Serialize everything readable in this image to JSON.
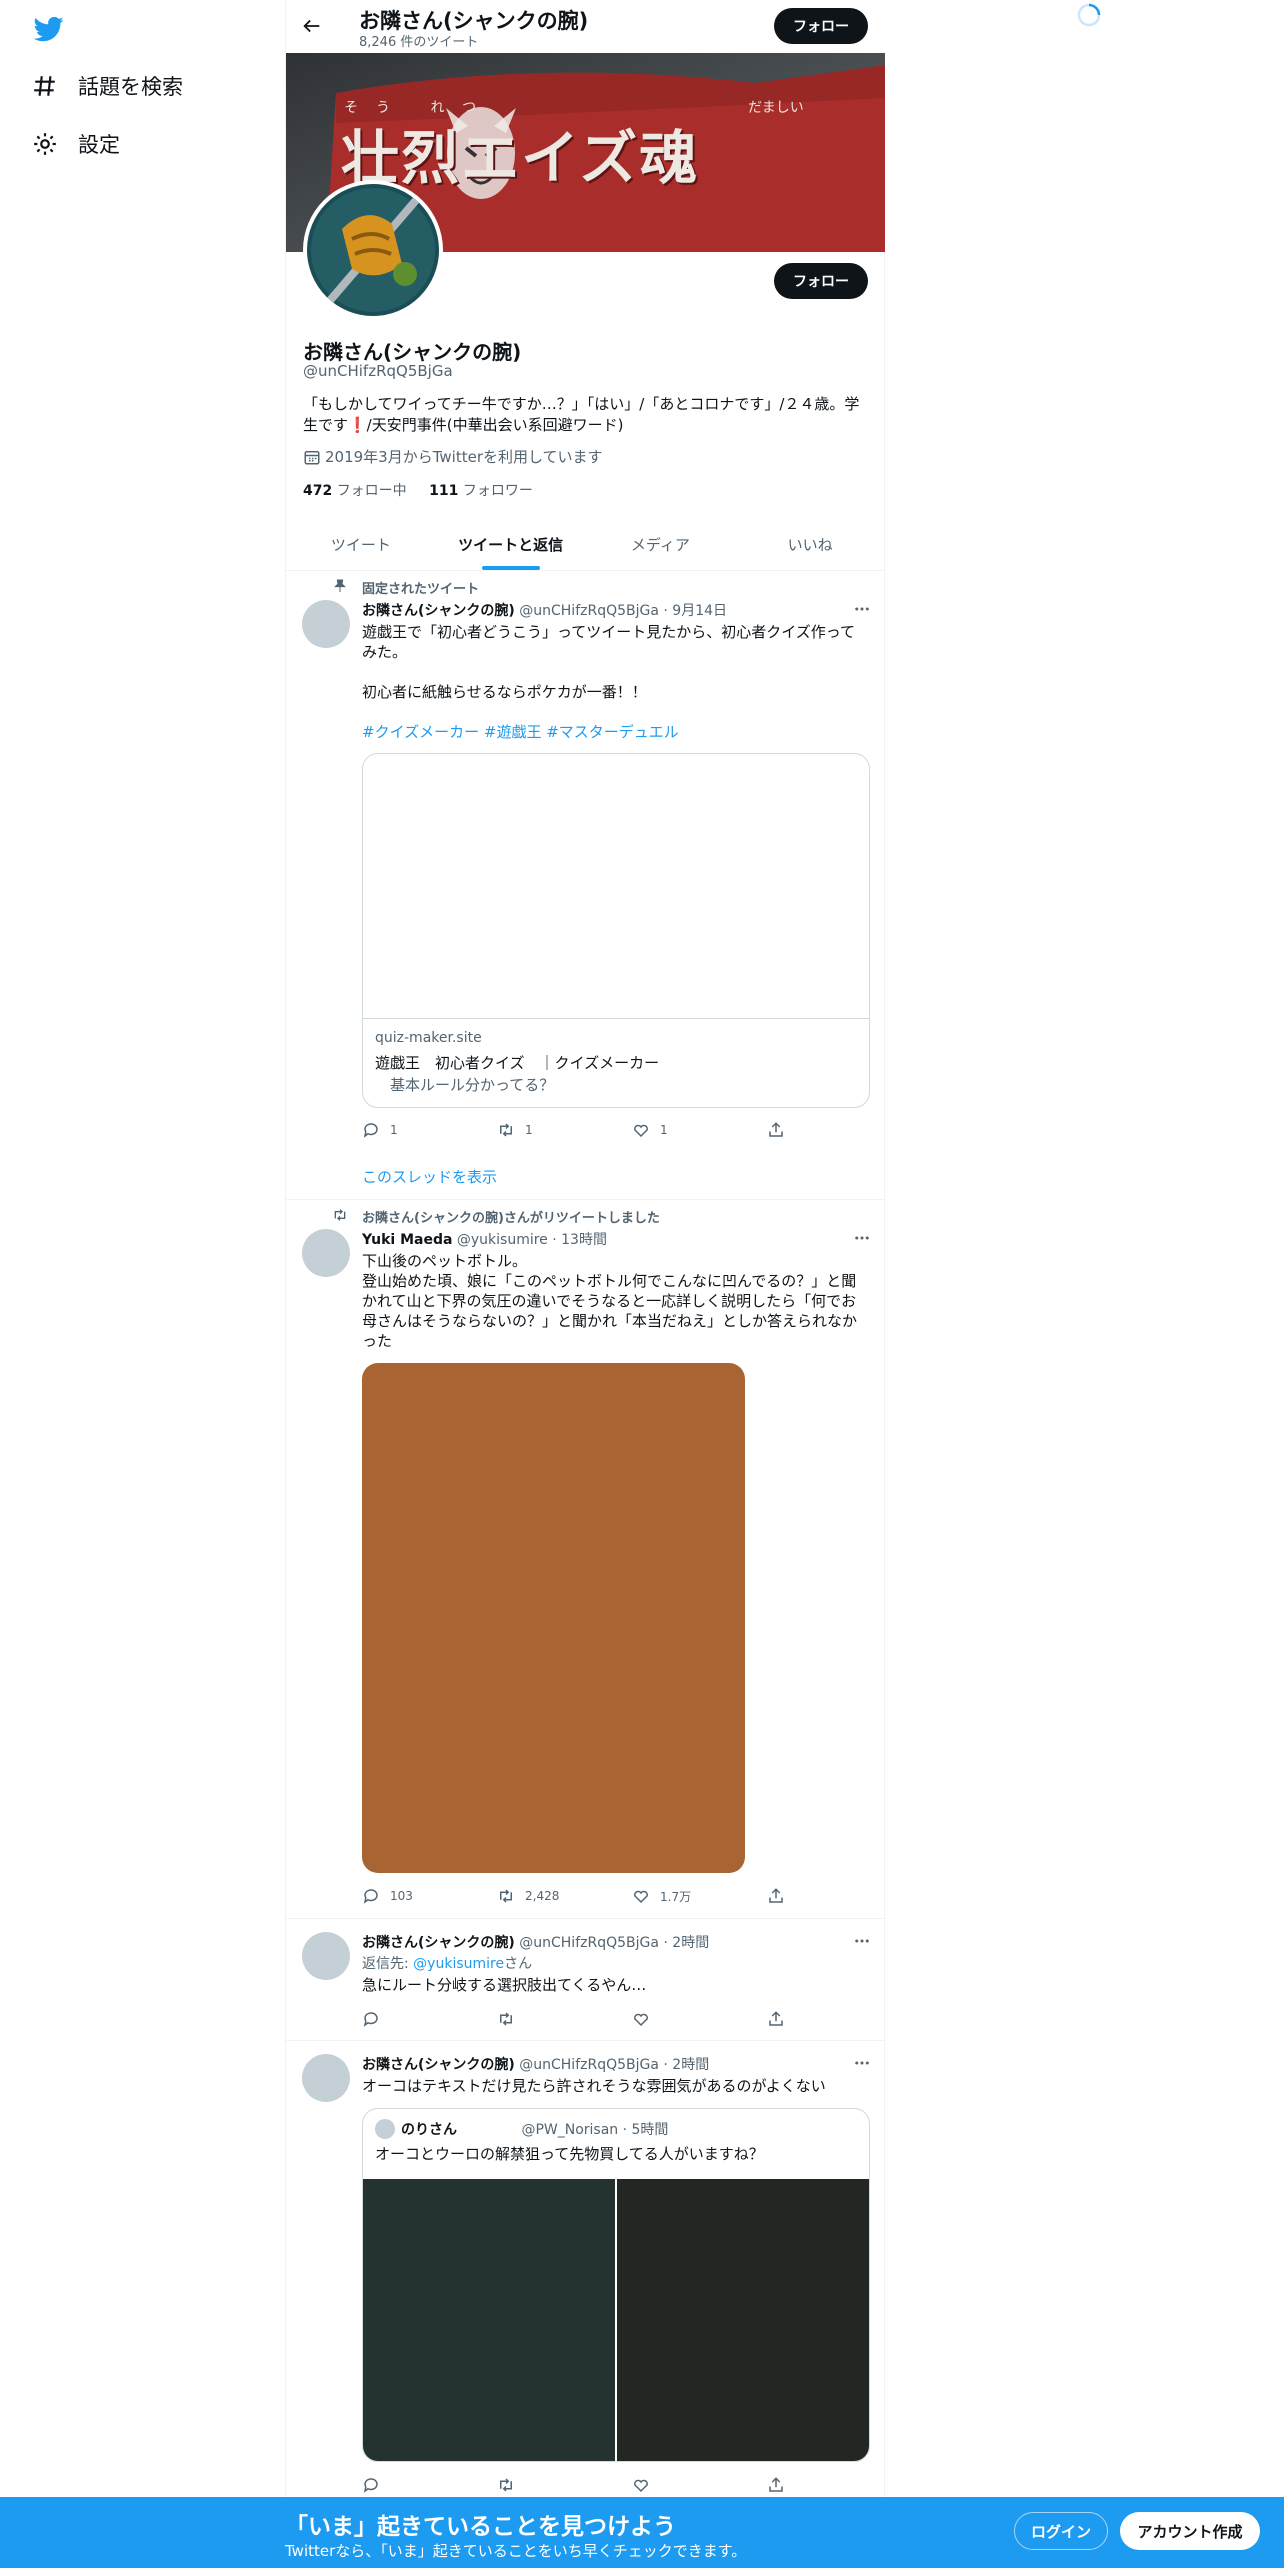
{
  "sidebar": {
    "items": [
      {
        "label": "話題を検索",
        "icon": "hashtag-icon"
      },
      {
        "label": "設定",
        "icon": "gear-icon"
      }
    ]
  },
  "header": {
    "name": "お隣さん(シャンクの腕)",
    "tweet_count": "8,246 件のツイート",
    "follow_label": "フォロー"
  },
  "banner": {
    "text": "壮烈エイズ魂",
    "ruby_left": "そう れつ",
    "ruby_right": "だましい"
  },
  "profile": {
    "name": "お隣さん(シャンクの腕)",
    "handle": "@unCHifzRqQ5BjGa",
    "bio": "「もしかしてワイってチー牛ですか…？」「はい」/「あとコロナです」/２４歳。学生です❗/天安門事件(中華出会い系回避ワード)",
    "joined": "2019年3月からTwitterを利用しています",
    "following_count": "472",
    "following_label": "フォロー中",
    "followers_count": "111",
    "followers_label": "フォロワー",
    "follow_label": "フォロー"
  },
  "tabs": [
    {
      "label": "ツイート",
      "active": false
    },
    {
      "label": "ツイートと返信",
      "active": true
    },
    {
      "label": "メディア",
      "active": false
    },
    {
      "label": "いいね",
      "active": false
    }
  ],
  "tweets": [
    {
      "context": "固定されたツイート",
      "name": "お隣さん(シャンクの腕)",
      "handle": "@unCHifzRqQ5BjGa",
      "time": "· 9月14日",
      "text_line1": "遊戯王で「初心者どうこう」ってツイート見たから、初心者クイズ作ってみた。",
      "text_line2": "初心者に紙触らせるならポケカが一番！！",
      "hashtags": "#クイズメーカー #遊戯王 #マスターデュエル",
      "card_domain": "quiz-maker.site",
      "card_title": "遊戯王　初心者クイズ　｜クイズメーカー",
      "card_desc": "　基本ルール分かってる？",
      "replies": "1",
      "retweets": "1",
      "likes": "1",
      "thread_link": "このスレッドを表示"
    },
    {
      "context": "お隣さん(シャンクの腕)さんがリツイートしました",
      "name": "Yuki Maeda",
      "handle": "@yukisumire",
      "time": "· 13時間",
      "text": "下山後のペットボトル。\n登山始めた頃、娘に「このペットボトル何でこんなに凹んでるの？」と聞かれて山と下界の気圧の違いでそうなると一応詳しく説明したら「何でお母さんはそうならないの？」と聞かれ「本当だねえ」としか答えられなかった",
      "media_color": "#a86533",
      "replies": "103",
      "retweets": "2,428",
      "likes": "1.7万"
    },
    {
      "name": "お隣さん(シャンクの腕)",
      "handle": "@unCHifzRqQ5BjGa",
      "time": "· 2時間",
      "reply_prefix": "返信先: ",
      "reply_to": "@yukisumire",
      "reply_suffix": "さん",
      "text": "急にルート分岐する選択肢出てくるやん…"
    },
    {
      "name": "お隣さん(シャンクの腕)",
      "handle": "@unCHifzRqQ5BjGa",
      "time": "· 2時間",
      "text": "オーコはテキストだけ見たら許されそうな雰囲気があるのがよくない",
      "quote_name": "のりさん",
      "quote_handle": "@PW_Norisan",
      "quote_time": "· 5時間",
      "quote_text": "オーコとウーロの解禁狙って先物買してる人がいますね？",
      "quote_img1_color": "#243230",
      "quote_img2_color": "#232723"
    }
  ],
  "bottom_bar": {
    "title": "「いま」起きていることを見つけよう",
    "subtitle": "Twitterなら、「いま」起きていることをいち早くチェックできます。",
    "login_label": "ログイン",
    "signup_label": "アカウント作成"
  },
  "colors": {
    "accent": "#1d9bf0",
    "text": "#0f1419",
    "secondary": "#536471"
  }
}
